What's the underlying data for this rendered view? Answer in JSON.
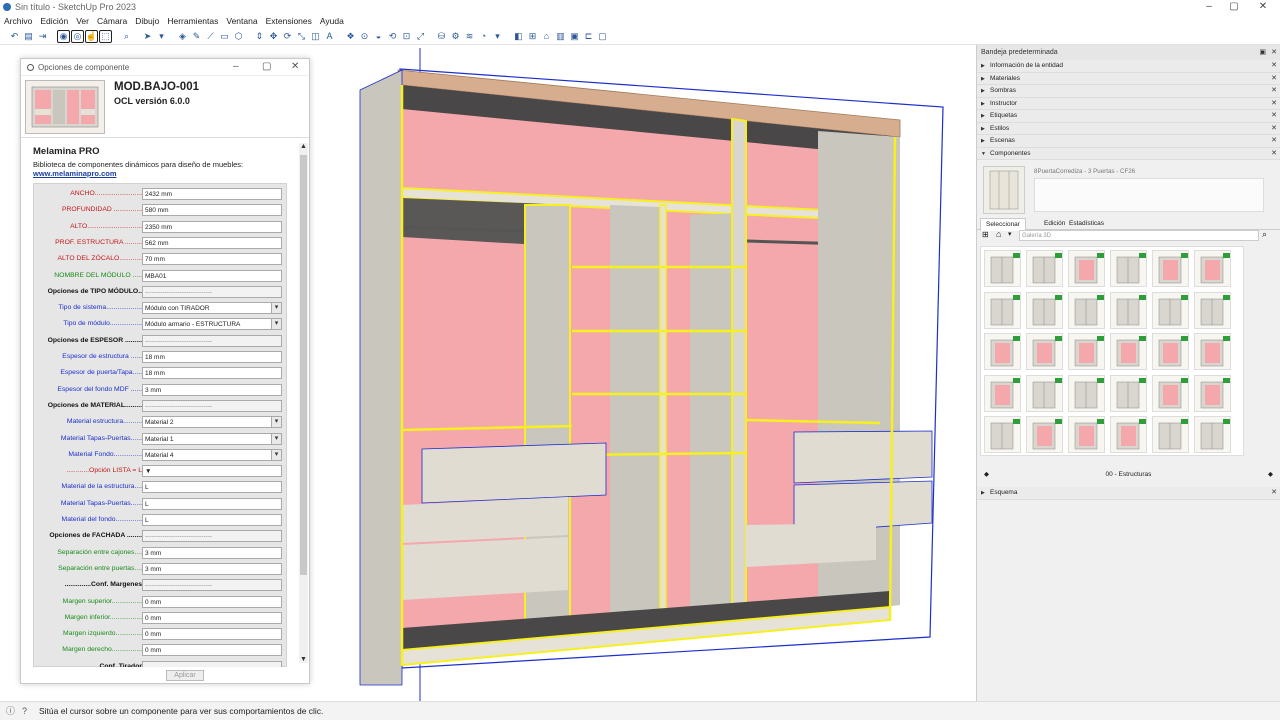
{
  "window": {
    "title": "Sin título - SketchUp Pro 2023"
  },
  "menu": [
    "Archivo",
    "Edición",
    "Ver",
    "Cámara",
    "Dibujo",
    "Herramientas",
    "Ventana",
    "Extensiones",
    "Ayuda"
  ],
  "dialog": {
    "title": "Opciones de componente",
    "component_name": "MOD.BAJO-001",
    "version": "OCL versión 6.0.0",
    "heading": "Melamina PRO",
    "description": "Biblioteca de componentes dinámicos para diseño de muebles:",
    "link": "www.melaminapro.com",
    "apply": "Aplicar",
    "rows": [
      {
        "label": "ANCHO.........................",
        "value": "2432 mm",
        "color": "red",
        "type": "input"
      },
      {
        "label": "PROFUNDIDAD ...............",
        "value": "580 mm",
        "color": "red",
        "type": "input"
      },
      {
        "label": "ALTO.............................",
        "value": "2350 mm",
        "color": "red",
        "type": "input"
      },
      {
        "label": "PROF. ESTRUCTURA .........",
        "value": "562 mm",
        "color": "red",
        "type": "input"
      },
      {
        "label": "ALTO DEL ZÓCALO............",
        "value": "70 mm",
        "color": "red",
        "type": "input"
      },
      {
        "label": "NOMBRE DEL MÓDULO .....",
        "value": "MBA01",
        "color": "green",
        "type": "input"
      },
      {
        "label": "Opciones de TIPO MÓDULO..",
        "value": "-------------------------------",
        "color": "black",
        "type": "section"
      },
      {
        "label": "Tipo de sistema...................",
        "value": "Módulo con TIRADOR",
        "color": "blue",
        "type": "select"
      },
      {
        "label": "Tipo de módulo.................",
        "value": "Módulo armario - ESTRUCTURA",
        "color": "blue",
        "type": "select"
      },
      {
        "label": "Opciones de ESPESOR .........",
        "value": "-------------------------------",
        "color": "black",
        "type": "section"
      },
      {
        "label": "Espesor de estructura ......",
        "value": "18 mm",
        "color": "blue",
        "type": "input"
      },
      {
        "label": "Espesor de puerta/Tapa.....",
        "value": "18 mm",
        "color": "blue",
        "type": "input"
      },
      {
        "label": "Espesor del fondo MDF ......",
        "value": "3 mm",
        "color": "blue",
        "type": "input"
      },
      {
        "label": "Opciones de MATERIAL.........",
        "value": "-------------------------------",
        "color": "black",
        "type": "section"
      },
      {
        "label": "Material estructura..........",
        "value": "Material 2",
        "color": "blue",
        "type": "select"
      },
      {
        "label": "Material Tapas-Puertas......",
        "value": "Material 1",
        "color": "blue",
        "type": "select"
      },
      {
        "label": "Material Fondo...............",
        "value": "Material 4",
        "color": "blue",
        "type": "select"
      },
      {
        "label": "............Opción LISTA = L",
        "value": "▼",
        "color": "red",
        "type": "input"
      },
      {
        "label": "Material de la estructura....",
        "value": "L",
        "color": "blue",
        "type": "input"
      },
      {
        "label": "Material Tapas-Puertas......",
        "value": "L",
        "color": "blue",
        "type": "input"
      },
      {
        "label": "Material del fondo..............",
        "value": "L",
        "color": "blue",
        "type": "input"
      },
      {
        "label": "Opciones de FACHADA ........",
        "value": "-------------------------------",
        "color": "black",
        "type": "section"
      },
      {
        "label": "Separación entre cajones....",
        "value": "3 mm",
        "color": "green",
        "type": "input"
      },
      {
        "label": "Separación entre puertas....",
        "value": "3 mm",
        "color": "green",
        "type": "input"
      },
      {
        "label": "..............Conf. Margenes",
        "value": "-------------------------------",
        "color": "black",
        "type": "section"
      },
      {
        "label": "Margen superior................",
        "value": "0 mm",
        "color": "green",
        "type": "input"
      },
      {
        "label": "Margen inferior.................",
        "value": "0 mm",
        "color": "green",
        "type": "input"
      },
      {
        "label": "Margen izquierdo..............",
        "value": "0 mm",
        "color": "green",
        "type": "input"
      },
      {
        "label": "Margen derecho................",
        "value": "0 mm",
        "color": "green",
        "type": "input"
      },
      {
        "label": "..............Conf. Tirador",
        "value": "-------------------------------",
        "color": "black",
        "type": "section"
      }
    ]
  },
  "tray": {
    "title": "Bandeja predeterminada",
    "sections": [
      "Información de la entidad",
      "Materiales",
      "Sombras",
      "Instructor",
      "Etiquetas",
      "Estilos",
      "Escenas"
    ],
    "components": {
      "label": "Componentes",
      "name": "8PuertaCorrediza - 3 Puertas - CF26",
      "tabs": [
        "Seleccionar",
        "Edición",
        "Estadísticas"
      ],
      "search_placeholder": "Galería 3D",
      "footer": "00 - Estructuras"
    },
    "esquema": "Esquema"
  },
  "status": {
    "text": "Sitúa el cursor sobre un componente para ver sus comportamientos de clic."
  },
  "colors": {
    "accent": "#1c2fcc",
    "red": "#c21818",
    "green": "#1a8a1a",
    "wood": "#d9d6cf",
    "pink": "#f4a8ac",
    "edge": "#f7f020"
  }
}
